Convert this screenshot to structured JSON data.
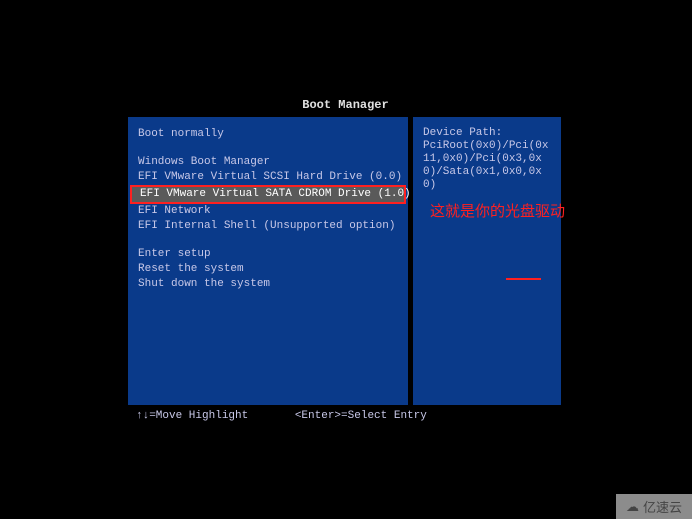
{
  "title": "Boot Manager",
  "menu": {
    "items": [
      {
        "label": "Boot normally",
        "highlighted": false
      },
      {
        "label": "",
        "gap": true
      },
      {
        "label": "Windows Boot Manager",
        "highlighted": false
      },
      {
        "label": "EFI VMware Virtual SCSI Hard Drive (0.0)",
        "highlighted": false
      },
      {
        "label": "EFI VMware Virtual SATA CDROM Drive (1.0)",
        "highlighted": true
      },
      {
        "label": "EFI Network",
        "highlighted": false
      },
      {
        "label": "EFI Internal Shell (Unsupported option)",
        "highlighted": false
      },
      {
        "label": "",
        "gap": true
      },
      {
        "label": "Enter setup",
        "highlighted": false
      },
      {
        "label": "Reset the system",
        "highlighted": false
      },
      {
        "label": "Shut down the system",
        "highlighted": false
      }
    ]
  },
  "info": {
    "label": "Device Path:",
    "value": "PciRoot(0x0)/Pci(0x11,0x0)/Pci(0x3,0x0)/Sata(0x1,0x0,0x0)"
  },
  "annotation": "这就是你的光盘驱动",
  "hints": {
    "move": "↑↓=Move Highlight",
    "select": "<Enter>=Select Entry"
  },
  "watermark": {
    "text": "亿速云",
    "icon": "☁"
  }
}
